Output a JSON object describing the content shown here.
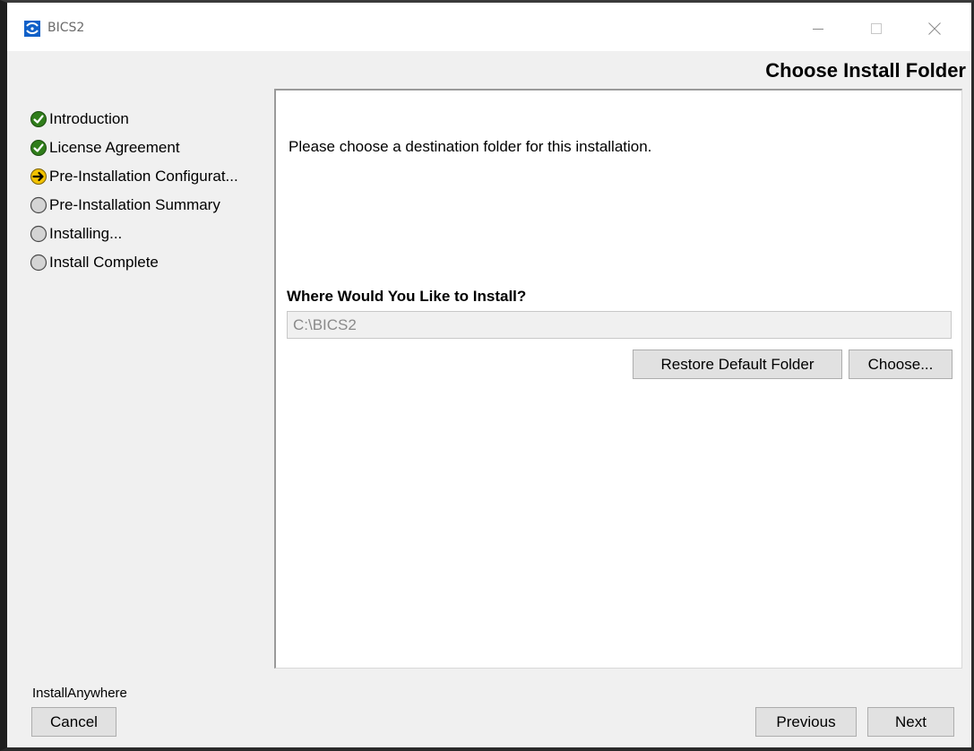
{
  "window": {
    "title": "BICS2"
  },
  "header": {
    "title": "Choose Install Folder"
  },
  "steps": [
    {
      "label": "Introduction",
      "status": "done",
      "icon": "check-circle-icon"
    },
    {
      "label": "License Agreement",
      "status": "done",
      "icon": "check-circle-icon"
    },
    {
      "label": "Pre-Installation Configurat...",
      "status": "current",
      "icon": "arrow-circle-icon"
    },
    {
      "label": "Pre-Installation Summary",
      "status": "pending",
      "icon": "empty-circle-icon"
    },
    {
      "label": "Installing...",
      "status": "pending",
      "icon": "empty-circle-icon"
    },
    {
      "label": "Install Complete",
      "status": "pending",
      "icon": "empty-circle-icon"
    }
  ],
  "content": {
    "instruction": "Please choose a destination folder for this installation.",
    "question": "Where Would You Like to Install?",
    "path_value": "C:\\BICS2",
    "restore_label": "Restore Default Folder",
    "choose_label": "Choose..."
  },
  "footer": {
    "vendor": "InstallAnywhere",
    "cancel_label": "Cancel",
    "previous_label": "Previous",
    "next_label": "Next"
  },
  "colors": {
    "done": "#2f7d1a",
    "current": "#f2c200",
    "pending": "#d4d4d4",
    "brand": "#1060c8"
  }
}
